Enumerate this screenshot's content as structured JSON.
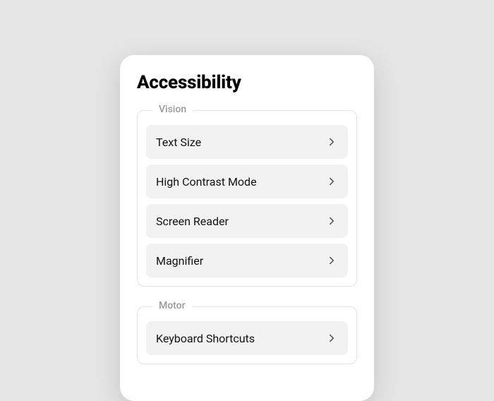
{
  "title": "Accessibility",
  "groups": [
    {
      "legend": "Vision",
      "items": [
        {
          "label": "Text Size"
        },
        {
          "label": "High Contrast Mode"
        },
        {
          "label": "Screen Reader"
        },
        {
          "label": "Magnifier"
        }
      ]
    },
    {
      "legend": "Motor",
      "items": [
        {
          "label": "Keyboard Shortcuts"
        }
      ]
    }
  ]
}
